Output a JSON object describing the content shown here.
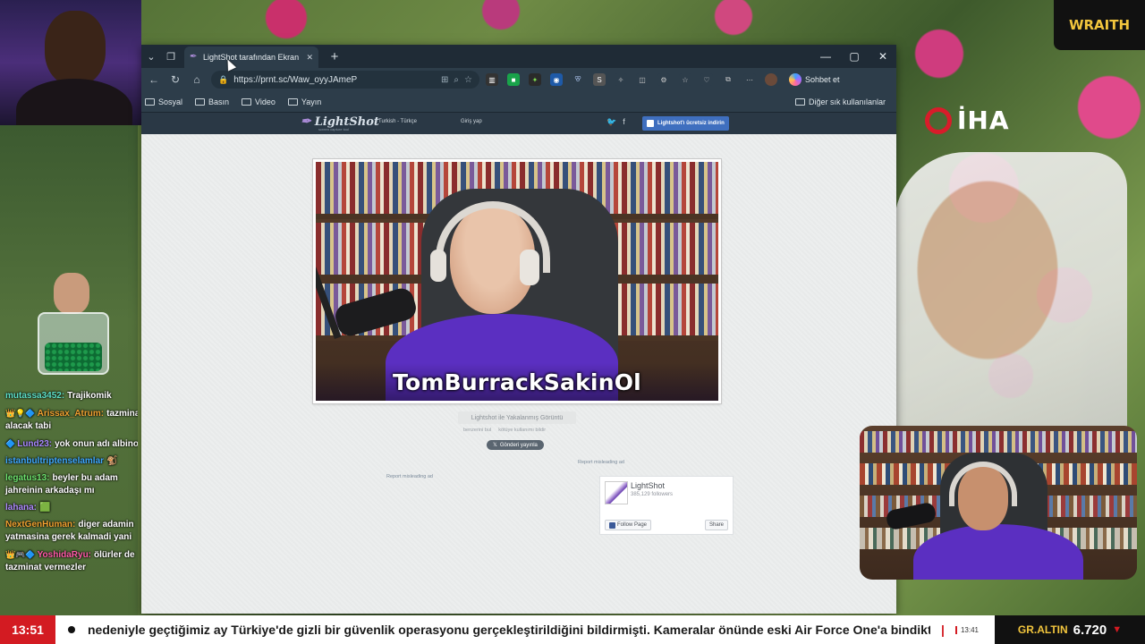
{
  "overlay": {
    "wraith_badge": "WRAITH",
    "iha_logo": "İHA"
  },
  "browser": {
    "tab_title": "LightShot tarafından Ekran Görüntü",
    "address_url": "https://prnt.sc/Waw_oyyJAmeP",
    "copilot_label": "Sohbet et",
    "bookmarks": [
      "Sosyal",
      "Basın",
      "Video",
      "Yayın"
    ],
    "other_bookmarks": "Diğer sık kullanılanlar"
  },
  "lightshot": {
    "logo": "LightShot",
    "tagline": "screen capture tool",
    "language": "Turkish - Türkçe",
    "login": "Giriş yap",
    "download_button": "Lightshot'ı ücretsiz indirin",
    "caption": "TomBurrackSakinOl",
    "captured_label": "Lightshot ile Yakalanmış Görüntü",
    "link_similar": "benzerini bul",
    "link_report": "kötüye kullanımı bildir",
    "share_button": "Gönderi yayınla",
    "report_ad_right": "Report misleading ad",
    "report_ad_left": "Report misleading ad",
    "fb_page_name": "LightShot",
    "fb_followers": "385,129 followers",
    "fb_follow": "Follow Page",
    "fb_share": "Share"
  },
  "chat": [
    {
      "user": "mutassa3452:",
      "user_color": "#5ee0c8",
      "badges": "",
      "text": "Trajikomik"
    },
    {
      "user": "Arissax_Atrum:",
      "user_color": "#f0a030",
      "badges": "👑💡🔷",
      "text": "tazminat alacak tabi"
    },
    {
      "user": "Lund23:",
      "user_color": "#a887ff",
      "badges": "🔷",
      "text": "yok onun adı albino"
    },
    {
      "user": "istanbultriptenselamlar",
      "user_color": "#3fa9ff",
      "badges": "",
      "text": "🐒"
    },
    {
      "user": "legatus13:",
      "user_color": "#6ee36e",
      "badges": "",
      "text": "beyler bu adam jahreinin arkadaşı mı"
    },
    {
      "user": "lahana:",
      "user_color": "#b08cff",
      "badges": "",
      "text": "🟩"
    },
    {
      "user": "NextGenHuman:",
      "user_color": "#f0a030",
      "badges": "",
      "text": "diger adamin yatmasina gerek kalmadi yani"
    },
    {
      "user": "YoshidaRyu:",
      "user_color": "#ff5aa8",
      "badges": "👑🎮🔷",
      "text": "ölürler de tazminat vermezler"
    }
  ],
  "ticker": {
    "time": "13:51",
    "headline": "nedeniyle geçtiğimiz ay Türkiye'de gizli bir güvenlik operasyonu gerçekleştirildiğini bildirmişti. Kameralar önünde eski Air Force One'a bindikten s",
    "separator": "|",
    "small_time": "13:41",
    "gold_label": "GR.ALTIN",
    "gold_value": "6.720",
    "gold_trend": "▼"
  },
  "colors": {
    "ticker_red": "#d31b22",
    "gold_yellow": "#f2c53d",
    "browser_dark": "#2d3d4a",
    "shirt_purple": "#5b2fc1"
  }
}
